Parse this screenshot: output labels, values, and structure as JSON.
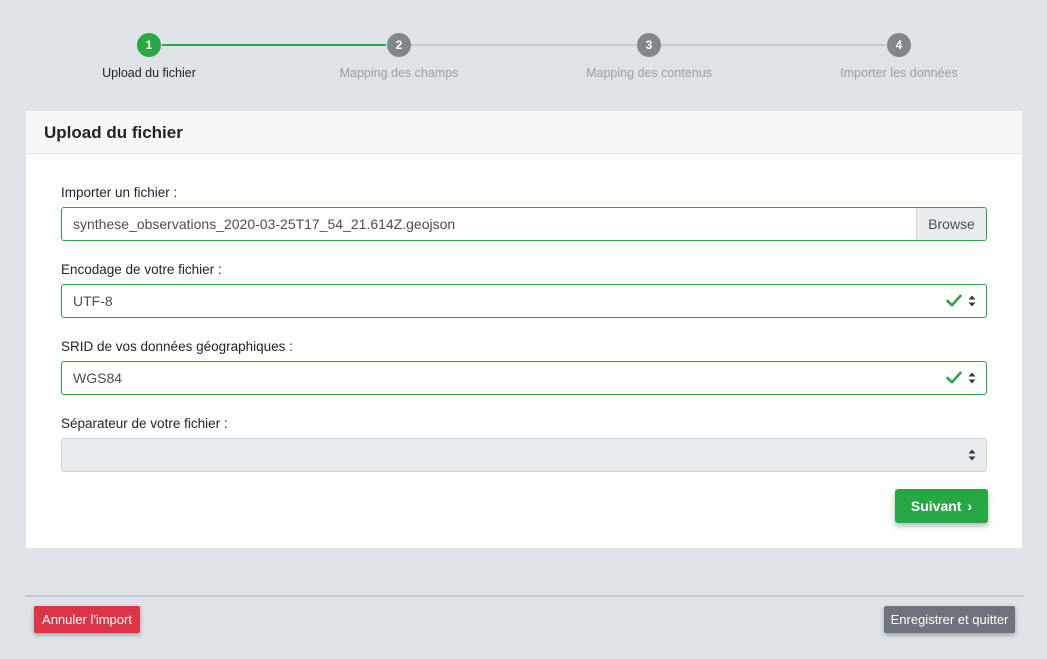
{
  "stepper": {
    "steps": [
      {
        "number": "1",
        "label": "Upload du fichier",
        "active": true
      },
      {
        "number": "2",
        "label": "Mapping des champs",
        "active": false
      },
      {
        "number": "3",
        "label": "Mapping des contenus",
        "active": false
      },
      {
        "number": "4",
        "label": "Importer les données",
        "active": false
      }
    ]
  },
  "card": {
    "title": "Upload du fichier",
    "file": {
      "label": "Importer un fichier :",
      "value": "synthese_observations_2020-03-25T17_54_21.614Z.geojson",
      "browse_label": "Browse"
    },
    "encoding": {
      "label": "Encodage de votre fichier :",
      "value": "UTF-8"
    },
    "srid": {
      "label": "SRID de vos données géographiques :",
      "value": "WGS84"
    },
    "separator": {
      "label": "Séparateur de votre fichier :",
      "value": ""
    },
    "next_label": "Suivant",
    "next_icon": "chevron-right-icon"
  },
  "footer": {
    "cancel_label": "Annuler l'import",
    "save_label": "Enregistrer et quitter"
  },
  "colors": {
    "success": "#28a745",
    "danger": "#dc3545",
    "secondary": "#6c757d",
    "background": "#dde3e7"
  }
}
